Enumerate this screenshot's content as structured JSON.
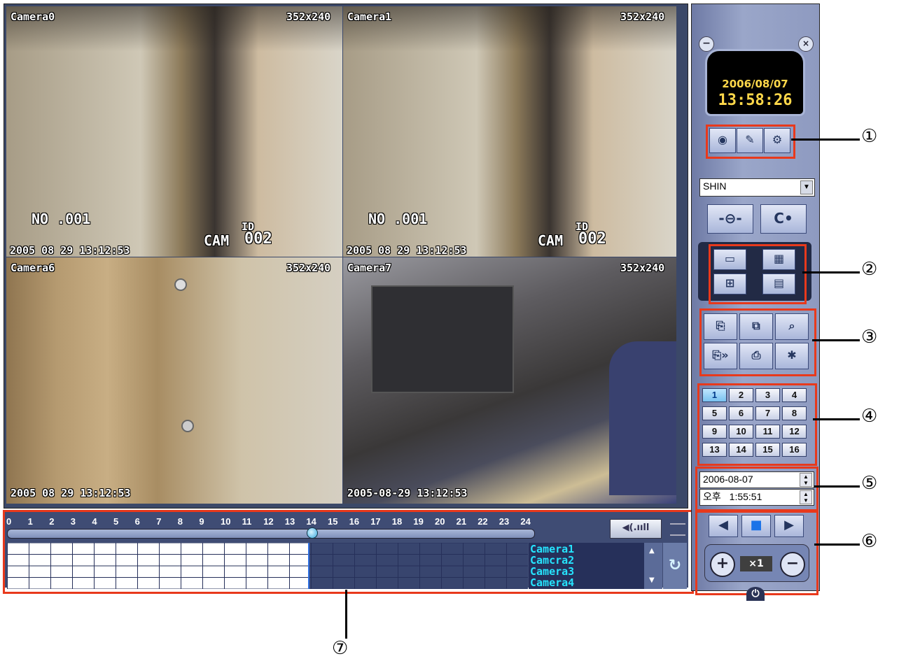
{
  "cameras": [
    {
      "name": "Camera0",
      "res": "352x240",
      "no": "NO .001",
      "cam": "CAM",
      "cam_id": "002",
      "id_small": "ID",
      "time": "2005 08 29 13:12:53",
      "bg": "#b9b19a"
    },
    {
      "name": "Camera1",
      "res": "352x240",
      "no": "NO .001",
      "cam": "CAM",
      "cam_id": "002",
      "id_small": "ID",
      "time": "2005 08 29 13:12:53",
      "bg": "#bbb49e"
    },
    {
      "name": "Camera6",
      "res": "352x240",
      "time": "2005 08 29 13:12:53",
      "bg": "#b59a70"
    },
    {
      "name": "Camera7",
      "res": "352x240",
      "time": "2005-08-29 13:12:53",
      "bg": "#6e6a6c"
    }
  ],
  "timeline": {
    "hours": [
      "0",
      "1",
      "2",
      "3",
      "4",
      "5",
      "6",
      "7",
      "8",
      "9",
      "10",
      "11",
      "12",
      "13",
      "14",
      "15",
      "16",
      "17",
      "18",
      "19",
      "20",
      "21",
      "22",
      "23",
      "24"
    ],
    "position_hour": 14,
    "volume_label": "◀(.ııll",
    "camera_names": [
      "Camera1",
      "Camcra2",
      "Camera3",
      "Camera4"
    ],
    "refresh_icon": "↻"
  },
  "clock": {
    "date": "2006/08/07",
    "time": "13:58:26"
  },
  "top_buttons": [
    "eye-icon",
    "wrench-icon",
    "gear-icon"
  ],
  "server": {
    "selected": "SHIN"
  },
  "connect_buttons": [
    "connect-icon",
    "disconnect-icon"
  ],
  "layout_buttons": [
    "layout-1x1-icon",
    "layout-4x4-icon",
    "layout-2x2-icon",
    "layout-3x3-icon"
  ],
  "function_buttons": [
    "record-icon",
    "save-icon",
    "search-icon",
    "play-record-icon",
    "print-icon",
    "settings-search-icon"
  ],
  "channels": [
    "1",
    "2",
    "3",
    "4",
    "5",
    "6",
    "7",
    "8",
    "9",
    "10",
    "11",
    "12",
    "13",
    "14",
    "15",
    "16"
  ],
  "selected_channel": "1",
  "search": {
    "date": "2006-08-07",
    "time_prefix": "오후",
    "time": "1:55:51"
  },
  "playback": {
    "speed": "×1",
    "prev": "◀",
    "stop": "■",
    "next": "▶",
    "faster": "+",
    "slower": "−"
  },
  "callouts": [
    "①",
    "②",
    "③",
    "④",
    "⑤",
    "⑥",
    "⑦"
  ]
}
